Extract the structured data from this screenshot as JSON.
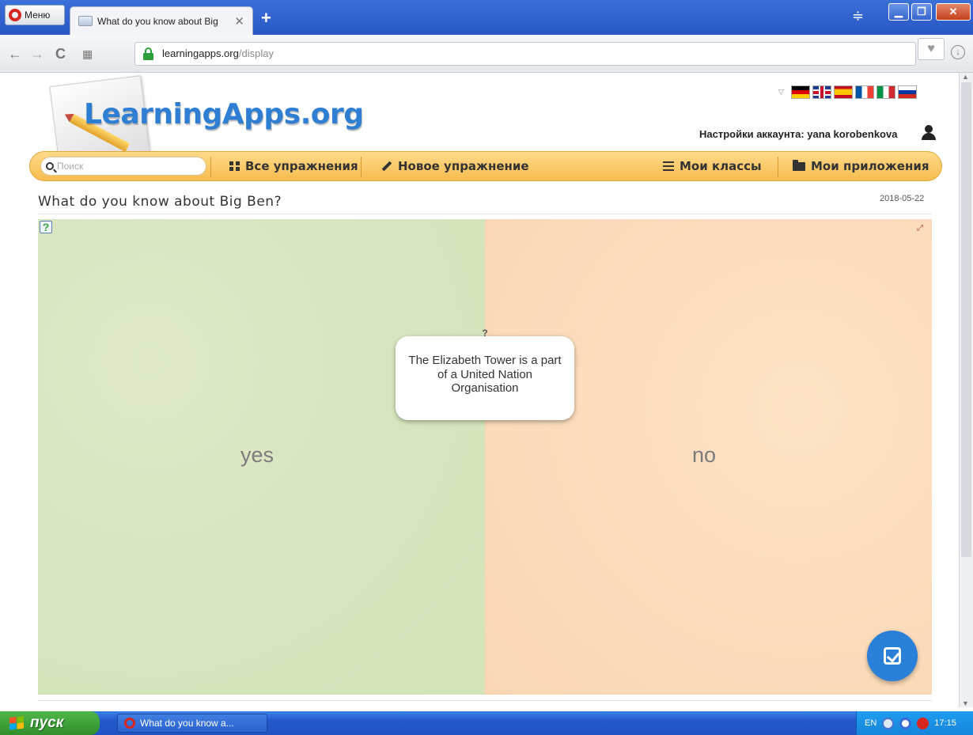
{
  "browser": {
    "menu_label": "Меню",
    "tab_title": "What do you know about Big",
    "tab_fade": "",
    "url_host": "learningapps.org",
    "url_path": "/display"
  },
  "site": {
    "logo_text": "LearningApps.org",
    "account_text": "Настройки аккаунта: yana korobenkova",
    "languages": [
      "de",
      "en",
      "es",
      "fr",
      "it",
      "ru"
    ],
    "search_placeholder": "Поиск",
    "nav": {
      "all_exercises": "Все упражнения",
      "new_exercise": "Новое упражнение",
      "my_classes": "Мои классы",
      "my_apps": "Мои приложения"
    },
    "accent_color": "#f6bd4f"
  },
  "app": {
    "title": "What do you know about Big Ben?",
    "date": "2018-05-22",
    "zone_left_label": "yes",
    "zone_right_label": "no",
    "card_marker": "?",
    "card_text": "The Elizabeth Tower is a part of a United Nation Organisation",
    "check_button_color": "#2a7fd9"
  },
  "taskbar": {
    "start_label": "пуск",
    "window_label": "What do you know a...",
    "lang": "EN",
    "clock": "17:15"
  }
}
